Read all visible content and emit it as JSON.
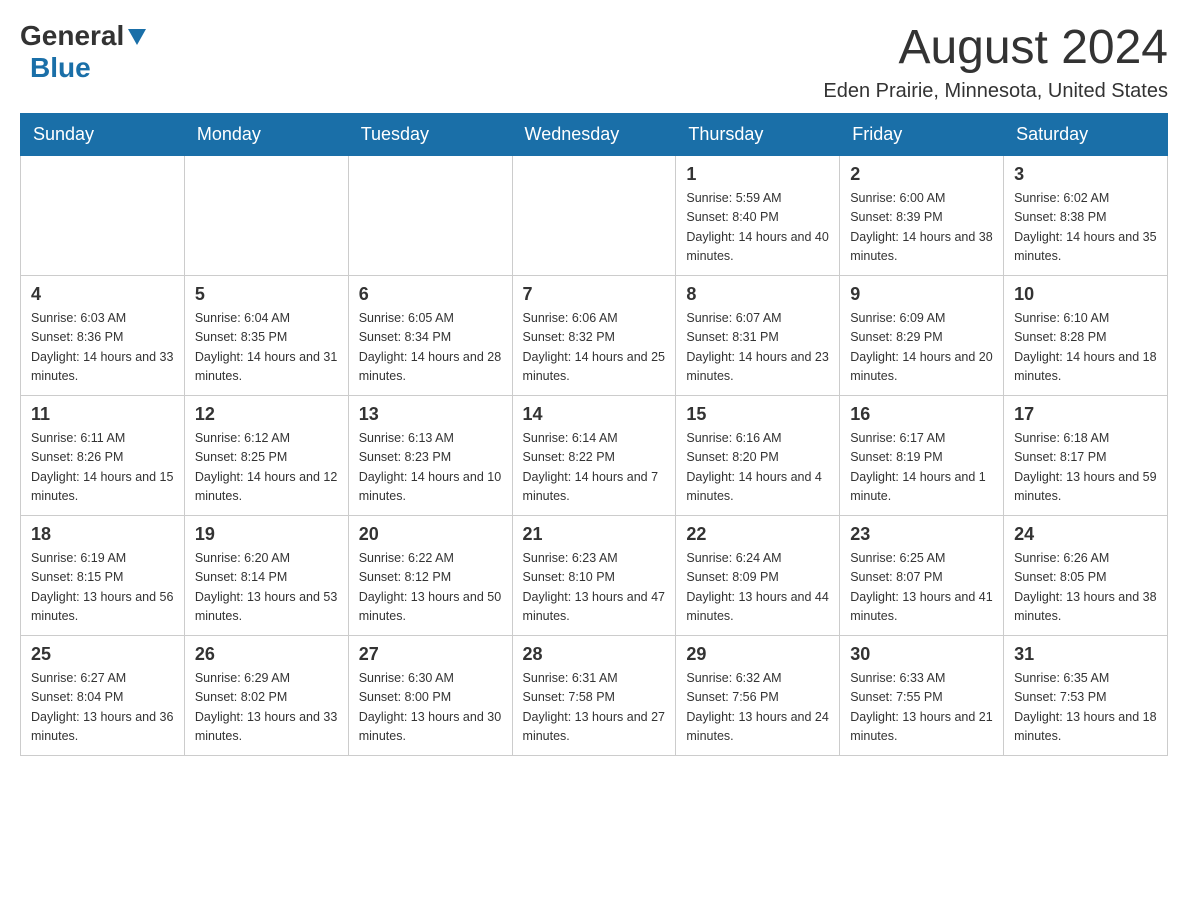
{
  "header": {
    "logo_general": "General",
    "logo_blue": "Blue",
    "month_title": "August 2024",
    "location": "Eden Prairie, Minnesota, United States"
  },
  "days_of_week": [
    "Sunday",
    "Monday",
    "Tuesday",
    "Wednesday",
    "Thursday",
    "Friday",
    "Saturday"
  ],
  "weeks": [
    {
      "days": [
        {
          "number": "",
          "sunrise": "",
          "sunset": "",
          "daylight": ""
        },
        {
          "number": "",
          "sunrise": "",
          "sunset": "",
          "daylight": ""
        },
        {
          "number": "",
          "sunrise": "",
          "sunset": "",
          "daylight": ""
        },
        {
          "number": "",
          "sunrise": "",
          "sunset": "",
          "daylight": ""
        },
        {
          "number": "1",
          "sunrise": "Sunrise: 5:59 AM",
          "sunset": "Sunset: 8:40 PM",
          "daylight": "Daylight: 14 hours and 40 minutes."
        },
        {
          "number": "2",
          "sunrise": "Sunrise: 6:00 AM",
          "sunset": "Sunset: 8:39 PM",
          "daylight": "Daylight: 14 hours and 38 minutes."
        },
        {
          "number": "3",
          "sunrise": "Sunrise: 6:02 AM",
          "sunset": "Sunset: 8:38 PM",
          "daylight": "Daylight: 14 hours and 35 minutes."
        }
      ]
    },
    {
      "days": [
        {
          "number": "4",
          "sunrise": "Sunrise: 6:03 AM",
          "sunset": "Sunset: 8:36 PM",
          "daylight": "Daylight: 14 hours and 33 minutes."
        },
        {
          "number": "5",
          "sunrise": "Sunrise: 6:04 AM",
          "sunset": "Sunset: 8:35 PM",
          "daylight": "Daylight: 14 hours and 31 minutes."
        },
        {
          "number": "6",
          "sunrise": "Sunrise: 6:05 AM",
          "sunset": "Sunset: 8:34 PM",
          "daylight": "Daylight: 14 hours and 28 minutes."
        },
        {
          "number": "7",
          "sunrise": "Sunrise: 6:06 AM",
          "sunset": "Sunset: 8:32 PM",
          "daylight": "Daylight: 14 hours and 25 minutes."
        },
        {
          "number": "8",
          "sunrise": "Sunrise: 6:07 AM",
          "sunset": "Sunset: 8:31 PM",
          "daylight": "Daylight: 14 hours and 23 minutes."
        },
        {
          "number": "9",
          "sunrise": "Sunrise: 6:09 AM",
          "sunset": "Sunset: 8:29 PM",
          "daylight": "Daylight: 14 hours and 20 minutes."
        },
        {
          "number": "10",
          "sunrise": "Sunrise: 6:10 AM",
          "sunset": "Sunset: 8:28 PM",
          "daylight": "Daylight: 14 hours and 18 minutes."
        }
      ]
    },
    {
      "days": [
        {
          "number": "11",
          "sunrise": "Sunrise: 6:11 AM",
          "sunset": "Sunset: 8:26 PM",
          "daylight": "Daylight: 14 hours and 15 minutes."
        },
        {
          "number": "12",
          "sunrise": "Sunrise: 6:12 AM",
          "sunset": "Sunset: 8:25 PM",
          "daylight": "Daylight: 14 hours and 12 minutes."
        },
        {
          "number": "13",
          "sunrise": "Sunrise: 6:13 AM",
          "sunset": "Sunset: 8:23 PM",
          "daylight": "Daylight: 14 hours and 10 minutes."
        },
        {
          "number": "14",
          "sunrise": "Sunrise: 6:14 AM",
          "sunset": "Sunset: 8:22 PM",
          "daylight": "Daylight: 14 hours and 7 minutes."
        },
        {
          "number": "15",
          "sunrise": "Sunrise: 6:16 AM",
          "sunset": "Sunset: 8:20 PM",
          "daylight": "Daylight: 14 hours and 4 minutes."
        },
        {
          "number": "16",
          "sunrise": "Sunrise: 6:17 AM",
          "sunset": "Sunset: 8:19 PM",
          "daylight": "Daylight: 14 hours and 1 minute."
        },
        {
          "number": "17",
          "sunrise": "Sunrise: 6:18 AM",
          "sunset": "Sunset: 8:17 PM",
          "daylight": "Daylight: 13 hours and 59 minutes."
        }
      ]
    },
    {
      "days": [
        {
          "number": "18",
          "sunrise": "Sunrise: 6:19 AM",
          "sunset": "Sunset: 8:15 PM",
          "daylight": "Daylight: 13 hours and 56 minutes."
        },
        {
          "number": "19",
          "sunrise": "Sunrise: 6:20 AM",
          "sunset": "Sunset: 8:14 PM",
          "daylight": "Daylight: 13 hours and 53 minutes."
        },
        {
          "number": "20",
          "sunrise": "Sunrise: 6:22 AM",
          "sunset": "Sunset: 8:12 PM",
          "daylight": "Daylight: 13 hours and 50 minutes."
        },
        {
          "number": "21",
          "sunrise": "Sunrise: 6:23 AM",
          "sunset": "Sunset: 8:10 PM",
          "daylight": "Daylight: 13 hours and 47 minutes."
        },
        {
          "number": "22",
          "sunrise": "Sunrise: 6:24 AM",
          "sunset": "Sunset: 8:09 PM",
          "daylight": "Daylight: 13 hours and 44 minutes."
        },
        {
          "number": "23",
          "sunrise": "Sunrise: 6:25 AM",
          "sunset": "Sunset: 8:07 PM",
          "daylight": "Daylight: 13 hours and 41 minutes."
        },
        {
          "number": "24",
          "sunrise": "Sunrise: 6:26 AM",
          "sunset": "Sunset: 8:05 PM",
          "daylight": "Daylight: 13 hours and 38 minutes."
        }
      ]
    },
    {
      "days": [
        {
          "number": "25",
          "sunrise": "Sunrise: 6:27 AM",
          "sunset": "Sunset: 8:04 PM",
          "daylight": "Daylight: 13 hours and 36 minutes."
        },
        {
          "number": "26",
          "sunrise": "Sunrise: 6:29 AM",
          "sunset": "Sunset: 8:02 PM",
          "daylight": "Daylight: 13 hours and 33 minutes."
        },
        {
          "number": "27",
          "sunrise": "Sunrise: 6:30 AM",
          "sunset": "Sunset: 8:00 PM",
          "daylight": "Daylight: 13 hours and 30 minutes."
        },
        {
          "number": "28",
          "sunrise": "Sunrise: 6:31 AM",
          "sunset": "Sunset: 7:58 PM",
          "daylight": "Daylight: 13 hours and 27 minutes."
        },
        {
          "number": "29",
          "sunrise": "Sunrise: 6:32 AM",
          "sunset": "Sunset: 7:56 PM",
          "daylight": "Daylight: 13 hours and 24 minutes."
        },
        {
          "number": "30",
          "sunrise": "Sunrise: 6:33 AM",
          "sunset": "Sunset: 7:55 PM",
          "daylight": "Daylight: 13 hours and 21 minutes."
        },
        {
          "number": "31",
          "sunrise": "Sunrise: 6:35 AM",
          "sunset": "Sunset: 7:53 PM",
          "daylight": "Daylight: 13 hours and 18 minutes."
        }
      ]
    }
  ]
}
